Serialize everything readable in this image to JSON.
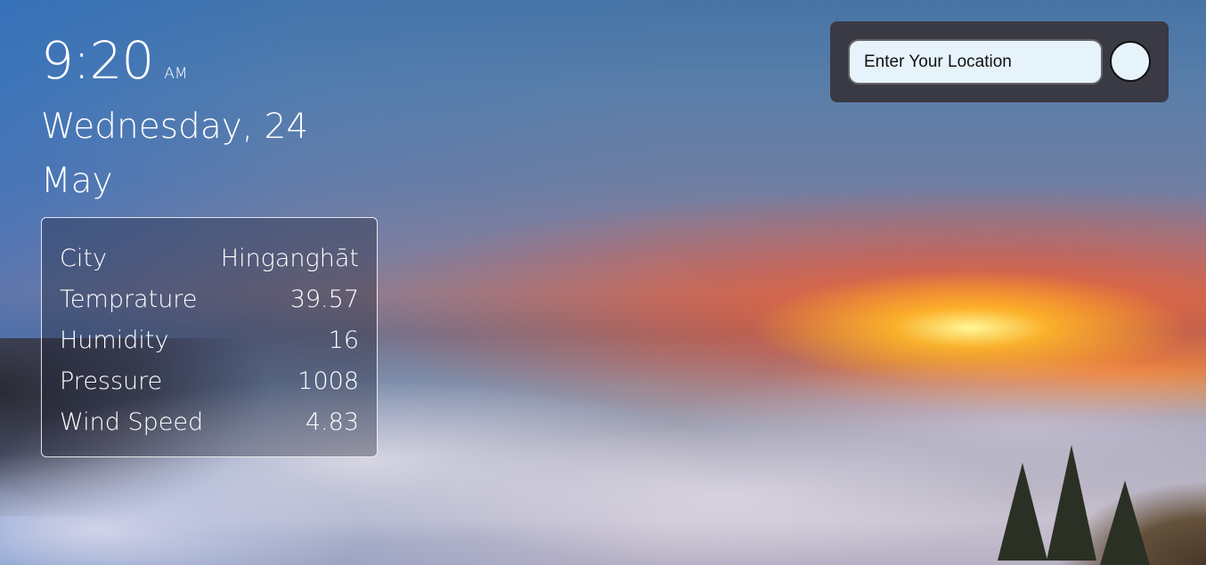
{
  "clock": {
    "time": "9:20",
    "ampm": "AM"
  },
  "date": {
    "weekday_day": "Wednesday, 24",
    "month": "May"
  },
  "weather": {
    "rows": [
      {
        "label": "City",
        "value": "Hinganghāt"
      },
      {
        "label": "Temprature",
        "value": "39.57"
      },
      {
        "label": "Humidity",
        "value": "16"
      },
      {
        "label": "Pressure",
        "value": "1008"
      },
      {
        "label": "Wind Speed",
        "value": "4.83"
      }
    ]
  },
  "search": {
    "placeholder": "Enter Your Location",
    "value": ""
  },
  "colors": {
    "panel": "#3a3a45",
    "input_bg": "#e6f3fb",
    "text": "#ffffff"
  }
}
